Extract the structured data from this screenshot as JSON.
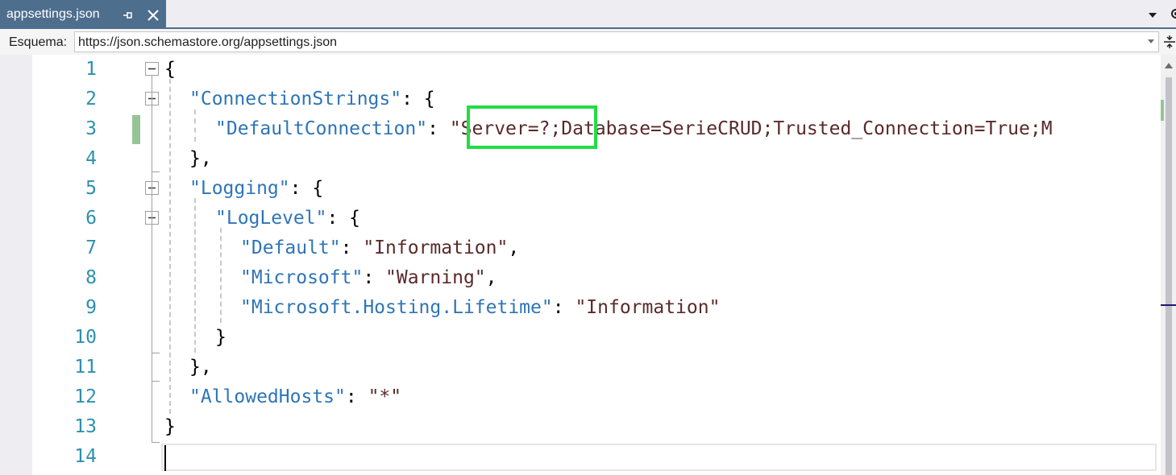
{
  "tab": {
    "title": "appsettings.json"
  },
  "schema": {
    "label": "Esquema:",
    "value": "https://json.schemastore.org/appsettings.json"
  },
  "editor": {
    "line_numbers": [
      "1",
      "2",
      "3",
      "4",
      "5",
      "6",
      "7",
      "8",
      "9",
      "10",
      "11",
      "12",
      "13",
      "14"
    ],
    "lines": {
      "l1": {
        "p1": "{"
      },
      "l2": {
        "k": "\"ConnectionStrings\"",
        "p1": ": {"
      },
      "l3": {
        "k": "\"DefaultConnection\"",
        "p1": ": ",
        "s": "\"Server=?;Database=SerieCRUD;Trusted_Connection=True;M"
      },
      "l4": {
        "p1": "},"
      },
      "l5": {
        "k": "\"Logging\"",
        "p1": ": {"
      },
      "l6": {
        "k": "\"LogLevel\"",
        "p1": ": {"
      },
      "l7": {
        "k": "\"Default\"",
        "p1": ": ",
        "s": "\"Information\"",
        "p2": ","
      },
      "l8": {
        "k": "\"Microsoft\"",
        "p1": ": ",
        "s": "\"Warning\"",
        "p2": ","
      },
      "l9": {
        "k": "\"Microsoft.Hosting.Lifetime\"",
        "p1": ": ",
        "s": "\"Information\""
      },
      "l10": {
        "p1": "}"
      },
      "l11": {
        "p1": "},"
      },
      "l12": {
        "k": "\"AllowedHosts\"",
        "p1": ": ",
        "s": "\"*\""
      },
      "l13": {
        "p1": "}"
      },
      "l14": {
        "p1": ""
      }
    }
  },
  "colors": {
    "tab_active": "#4e6e8e",
    "line_number": "#2b91af",
    "json_key": "#2e75b6",
    "json_string": "#5a2a2a",
    "highlight": "#22dd44",
    "change_marker": "#96c496"
  }
}
